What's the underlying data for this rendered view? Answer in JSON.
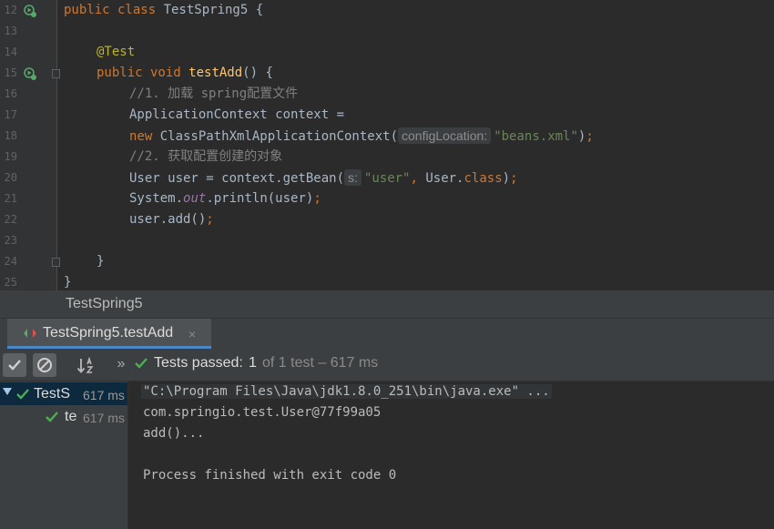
{
  "editor": {
    "lines": [
      {
        "n": "12"
      },
      {
        "n": "13"
      },
      {
        "n": "14"
      },
      {
        "n": "15"
      },
      {
        "n": "16"
      },
      {
        "n": "17"
      },
      {
        "n": "18"
      },
      {
        "n": "19"
      },
      {
        "n": "20"
      },
      {
        "n": "21"
      },
      {
        "n": "22"
      },
      {
        "n": "23"
      },
      {
        "n": "24"
      },
      {
        "n": "25"
      }
    ],
    "code": {
      "l12_kw": "public class ",
      "l12_rest": "TestSpring5 {",
      "l14_ann": "@Test",
      "l15_kw": "public void ",
      "l15_fn": "testAdd",
      "l15_rest": "() {",
      "l16_cm": "//1. 加载 spring配置文件",
      "l17": "ApplicationContext context =",
      "l18_kw": "new ",
      "l18_a": "ClassPathXmlApplicationContext(",
      "l18_hint": "configLocation:",
      "l18_str": "\"beans.xml\"",
      "l18_b": ")",
      "l18_semi": ";",
      "l19_cm": "//2. 获取配置创建的对象",
      "l20_a": "User user = context.getBean(",
      "l20_hint": "s:",
      "l20_str": "\"user\"",
      "l20_comma": ", ",
      "l20_b": "User.",
      "l20_kw": "class",
      "l20_c": ")",
      "l20_semi": ";",
      "l21_a": "System.",
      "l21_fld": "out",
      "l21_b": ".println(user)",
      "l21_semi": ";",
      "l22_a": "user.add()",
      "l22_semi": ";",
      "l24": "}",
      "l25": "}"
    }
  },
  "breadcrumb": "TestSpring5",
  "run_tab": {
    "label": "TestSpring5.testAdd",
    "close": "×"
  },
  "toolbar": {
    "more": "»",
    "status_label": "Tests passed:",
    "status_passed": "1",
    "status_total": "of 1 test – 617 ms"
  },
  "tree": {
    "items": [
      {
        "name": "TestS",
        "time": "617 ms"
      },
      {
        "name": "te",
        "time": "617 ms"
      }
    ]
  },
  "console": {
    "lines": [
      "\"C:\\Program Files\\Java\\jdk1.8.0_251\\bin\\java.exe\" ...",
      "com.springio.test.User@77f99a05",
      "add()...",
      "",
      "Process finished with exit code 0"
    ]
  },
  "colors": {
    "keyword": "#cc7832",
    "function": "#ffc66d",
    "string": "#6a8759",
    "comment": "#808080",
    "annotation": "#bbb529",
    "passed": "#4caf50"
  },
  "icons": {
    "run_gutter": "run-test-icon",
    "passed": "check-icon",
    "ignored": "ignored-icon",
    "sort": "sort-alpha-icon"
  }
}
